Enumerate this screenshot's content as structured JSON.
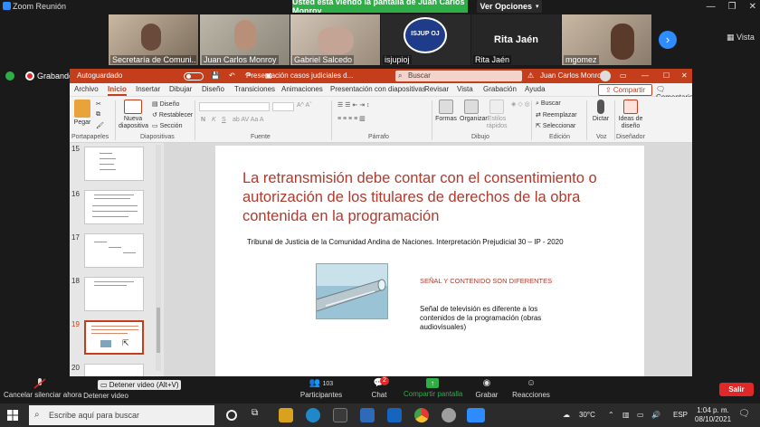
{
  "zoom": {
    "window_title": "Zoom Reunión",
    "share_banner": "Usted está viendo la pantalla de Juan Carlos Monroy",
    "view_options": "Ver Opciones",
    "vista_label": "Vista",
    "recording_label": "Grabando",
    "participants": [
      {
        "name": "Secretaría de Comuni...",
        "bg": "#7a6a5a"
      },
      {
        "name": "Juan Carlos Monroy",
        "bg": "#8a8478"
      },
      {
        "name": "Gabriel Salcedo",
        "bg": "#9a8a7a"
      },
      {
        "name": "isjupioj",
        "bg": "#2a2a2a"
      },
      {
        "name": "Rita Jaén",
        "bg": "#262626"
      },
      {
        "name": "mgomez",
        "bg": "#8a7a6a"
      }
    ],
    "tile_center_name": "Rita Jaén",
    "logo_text": "ISJUP OJ",
    "toolbar": {
      "mute": "Cancelar silenciar ahora",
      "video": "Detener video",
      "video_tooltip": "Detener video (Alt+V)",
      "participants": "Participantes",
      "participants_count": "103",
      "chat": "Chat",
      "chat_badge": "2",
      "share": "Compartir pantalla",
      "record": "Grabar",
      "reactions": "Reacciones",
      "leave": "Salir"
    }
  },
  "ppt": {
    "autosave": "Autoguardado",
    "autosave_state": "Desactivado",
    "doc_title": "Presentación casos judiciales d...",
    "search_placeholder": "Buscar",
    "user": "Juan Carlos Monroy",
    "tabs": [
      "Archivo",
      "Inicio",
      "Insertar",
      "Dibujar",
      "Diseño",
      "Transiciones",
      "Animaciones",
      "Presentación con diapositivas",
      "Revisar",
      "Vista",
      "Grabación",
      "Ayuda"
    ],
    "active_tab": "Inicio",
    "share_label": "Compartir",
    "comments_label": "Comentarios",
    "ribbon": {
      "paste": "Pegar",
      "new_slide": "Nueva diapositiva",
      "layout": "Diseño",
      "reset": "Restablecer",
      "section": "Sección",
      "shapes": "Formas",
      "arrange": "Organizar",
      "quick_styles": "Estilos rápidos",
      "search": "Buscar",
      "replace": "Reemplazar",
      "select": "Seleccionar",
      "dictate": "Dictar",
      "designer": "Ideas de diseño",
      "groups": {
        "clipboard": "Portapapeles",
        "slides": "Diapositivas",
        "font": "Fuente",
        "paragraph": "Párrafo",
        "drawing": "Dibujo",
        "editing": "Edición",
        "voice": "Voz",
        "designer": "Diseñador"
      }
    },
    "thumbnails": [
      "15",
      "16",
      "17",
      "18",
      "19",
      "20"
    ],
    "selected_slide": "19",
    "slide": {
      "title": "La retransmisión debe contar con el consentimiento o autorización de los titulares de derechos de la obra contenida en la programación",
      "subtitle": "Tribunal de Justicia de la Comunidad Andina de Naciones. Interpretación Prejudicial 30 – IP - 2020",
      "heading": "SEÑAL Y CONTENIDO SON DIFERENTES",
      "body": "Señal de televisión es diferente a los contenidos de la programación (obras audiovisuales)"
    }
  },
  "taskbar": {
    "search_placeholder": "Escribe aquí para buscar",
    "weather": "30°C",
    "lang": "ESP",
    "time": "1:04 p. m.",
    "date": "08/10/2021"
  },
  "colors": {
    "ppt_accent": "#c43e1c",
    "zoom_green": "#2fae48",
    "zoom_red": "#e02828",
    "slide_title": "#b03a2e"
  }
}
